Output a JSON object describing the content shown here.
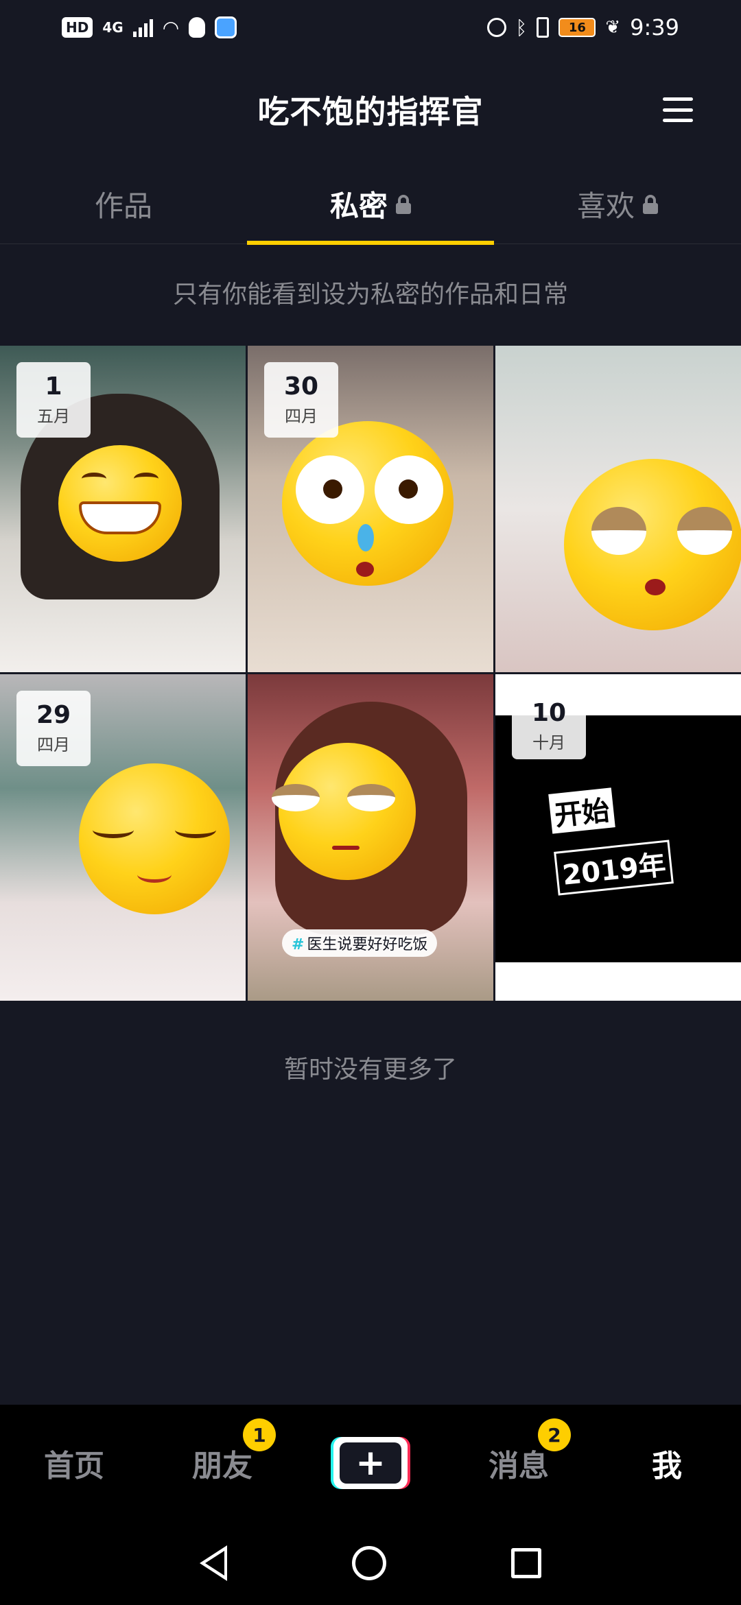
{
  "status_bar": {
    "left_icons": [
      "HD",
      "4G",
      "signal-icon",
      "wifi-icon",
      "qq-icon",
      "app-icon"
    ],
    "hd": "HD",
    "net": "4G",
    "battery": "16",
    "time": "9:39"
  },
  "header": {
    "title": "吃不饱的指挥官"
  },
  "tabs": [
    {
      "label": "作品",
      "locked": false
    },
    {
      "label": "私密",
      "locked": true,
      "active": true
    },
    {
      "label": "喜欢",
      "locked": true
    }
  ],
  "notice": "只有你能看到设为私密的作品和日常",
  "grid": [
    {
      "day": "1",
      "month": "五月"
    },
    {
      "day": "30",
      "month": "四月"
    },
    {
      "day": "",
      "month": ""
    },
    {
      "day": "29",
      "month": "四月"
    },
    {
      "day": "",
      "month": "",
      "tag": "医生说要好好吃饭"
    },
    {
      "day": "10",
      "month": "十月",
      "logo_kai": "开始",
      "logo_year": "2019年"
    }
  ],
  "more_text": "暂时没有更多了",
  "bottom_nav": {
    "home": "首页",
    "friends": "朋友",
    "friends_badge": "1",
    "create": "+",
    "messages": "消息",
    "messages_badge": "2",
    "me": "我"
  },
  "colors": {
    "background": "#161823",
    "accent": "#fece00",
    "muted": "#8a8b91"
  }
}
